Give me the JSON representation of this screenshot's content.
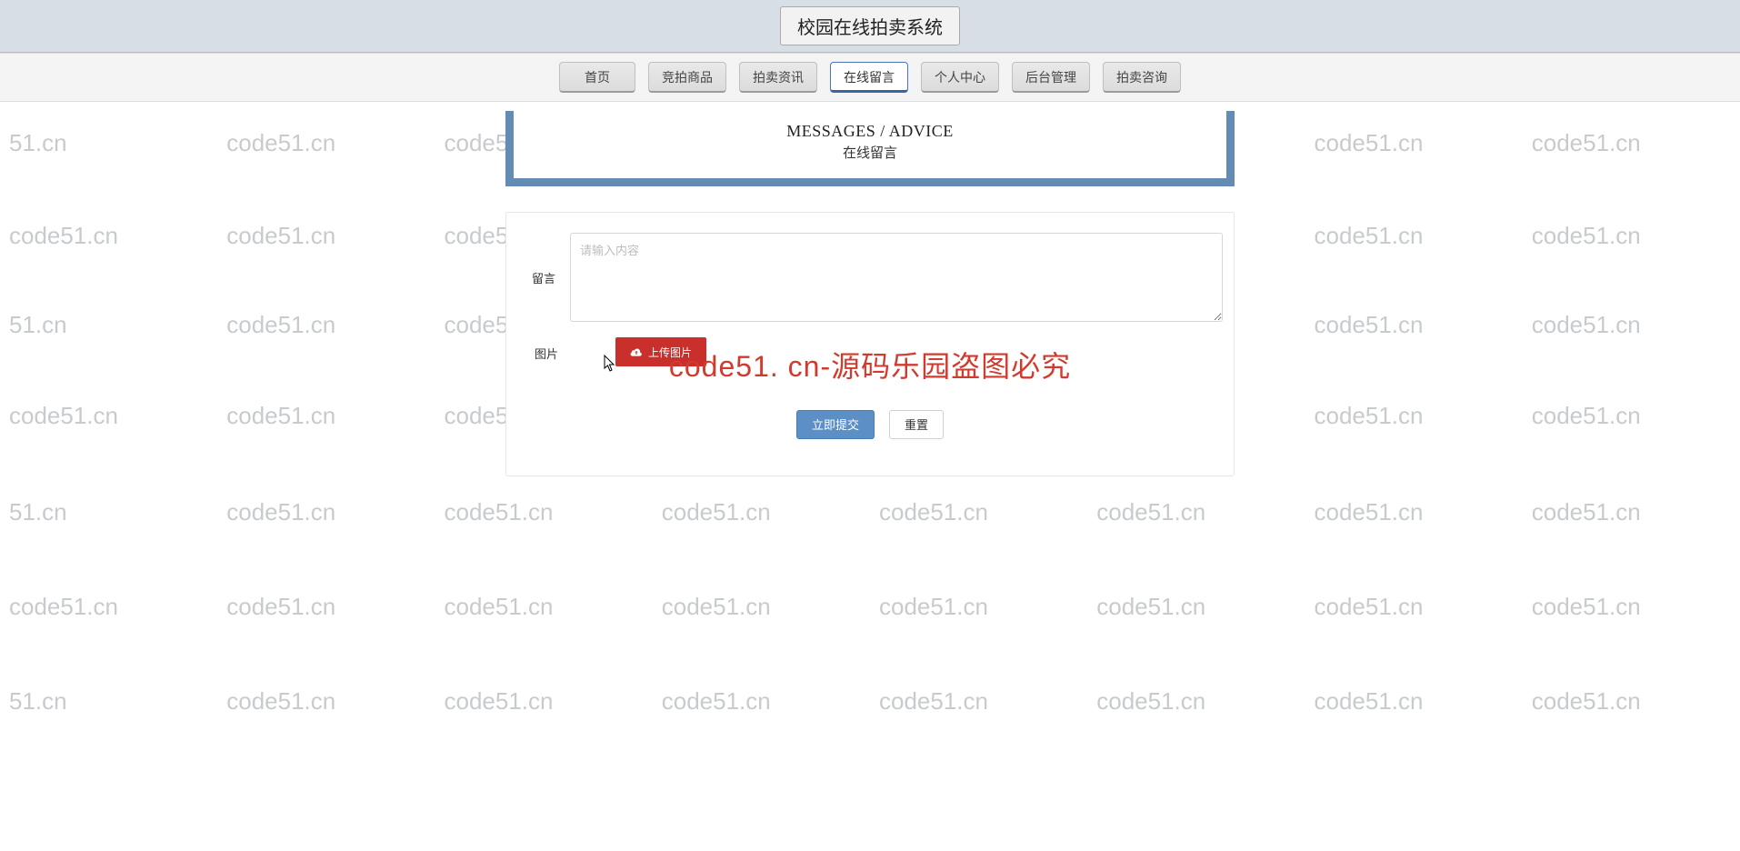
{
  "site": {
    "title": "校园在线拍卖系统"
  },
  "nav": {
    "items": [
      {
        "label": "首页",
        "active": false
      },
      {
        "label": "竞拍商品",
        "active": false
      },
      {
        "label": "拍卖资讯",
        "active": false
      },
      {
        "label": "在线留言",
        "active": true
      },
      {
        "label": "个人中心",
        "active": false
      },
      {
        "label": "后台管理",
        "active": false
      },
      {
        "label": "拍卖咨询",
        "active": false
      }
    ]
  },
  "header": {
    "title_en": "MESSAGES / ADVICE",
    "title_cn": "在线留言"
  },
  "form": {
    "message_label": "留言",
    "message_placeholder": "请输入内容",
    "message_value": "",
    "image_label": "图片",
    "upload_label": "上传图片",
    "submit_label": "立即提交",
    "reset_label": "重置"
  },
  "watermark": {
    "text": "code51.cn",
    "suffix_text": "51.cn",
    "overlay": "code51. cn-源码乐园盗图必究"
  }
}
